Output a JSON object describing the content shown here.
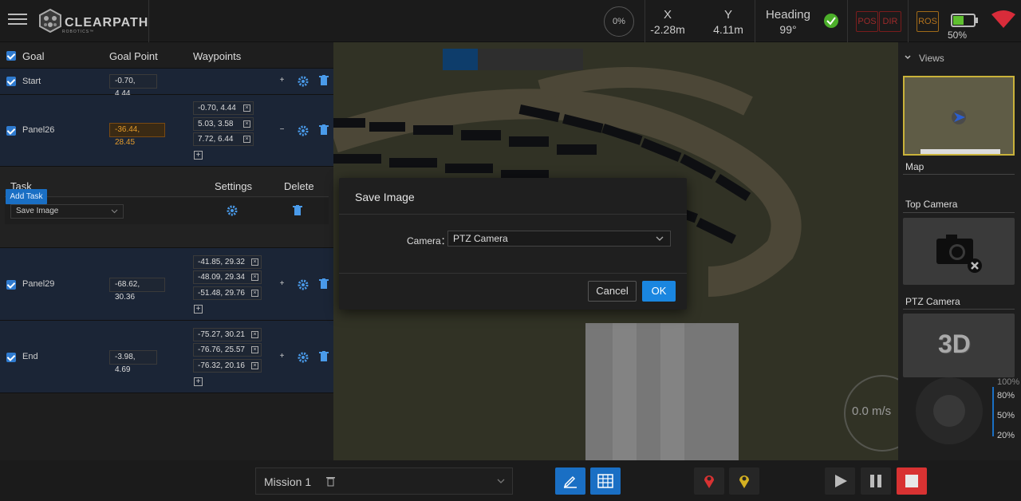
{
  "app": {
    "logo_text": "CLEARPATH",
    "logo_sub": "ROBOTICS™"
  },
  "telemetry": {
    "progress": "0%",
    "x_label": "X",
    "x_value": "-2.28m",
    "y_label": "Y",
    "y_value": "4.11m",
    "heading_label": "Heading",
    "heading_value": "99°",
    "pos_badge": "POS",
    "dir_badge": "DIR",
    "ros_badge": "ROS",
    "battery_pct": "50%",
    "battery_level": 0.5
  },
  "goal_table": {
    "headers": {
      "goal": "Goal",
      "goal_point": "Goal Point",
      "waypoints": "Waypoints"
    },
    "rows": [
      {
        "name": "Start",
        "point": "-0.70, 4.44",
        "waypoints": []
      },
      {
        "name": "Panel26",
        "point": "-36.44, 28.45",
        "waypoints": [
          "-0.70, 4.44",
          "5.03, 3.58",
          "7.72, 6.44"
        ]
      },
      {
        "name": "Panel29",
        "point": "-68.62, 30.36",
        "waypoints": [
          "-41.85, 29.32",
          "-48.09, 29.34",
          "-51.48, 29.76"
        ]
      },
      {
        "name": "End",
        "point": "-3.98, 4.69",
        "waypoints": [
          "-75.27, 30.21",
          "-76.76, 25.57",
          "-76.32, 20.16"
        ]
      }
    ]
  },
  "task_table": {
    "headers": {
      "task": "Task",
      "settings": "Settings",
      "delete": "Delete"
    },
    "task_value": "Save Image",
    "add_task": "Add Task"
  },
  "right_panel": {
    "views_label": "Views",
    "map_label": "Map",
    "top_camera_label": "Top Camera",
    "ptz_camera_label": "PTZ Camera",
    "threed_label": "3D"
  },
  "speed": {
    "value": "0.0 m/s",
    "ticks": [
      "100%",
      "80%",
      "50%",
      "20%"
    ]
  },
  "dialog": {
    "title": "Save Image",
    "camera_label": "Camera：",
    "camera_value": "PTZ Camera",
    "cancel": "Cancel",
    "ok": "OK"
  },
  "bottom": {
    "mission_value": "Mission 1"
  },
  "colors": {
    "accent": "#1a86e0",
    "warning": "#e39b2b",
    "danger": "#e04040",
    "ok": "#5fbf2f"
  }
}
